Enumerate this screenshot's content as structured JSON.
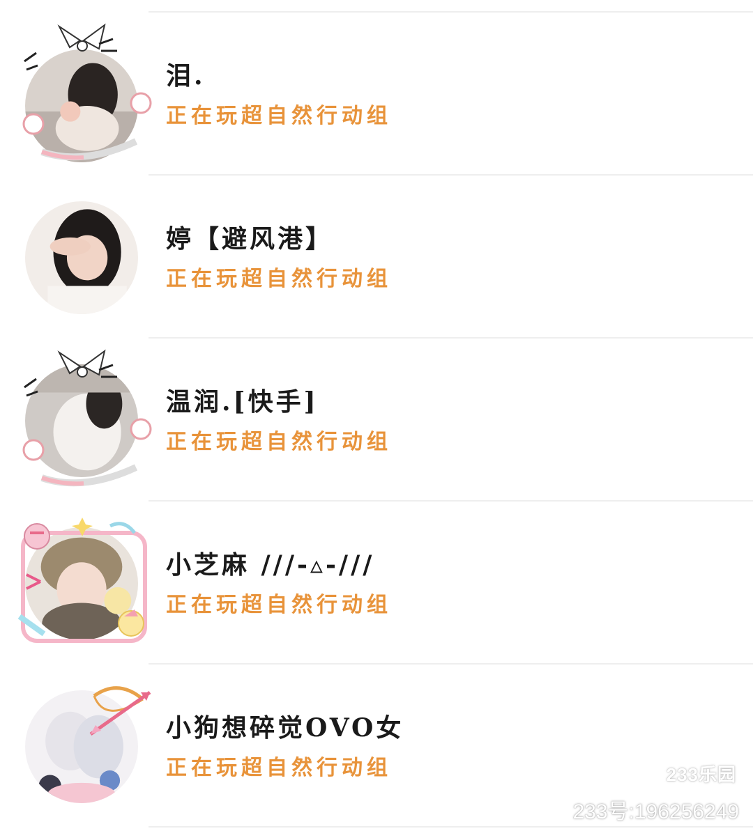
{
  "users": [
    {
      "name": "泪.",
      "status": "正在玩超自然行动组",
      "avatar_frame": "cat-ear-bow-frame"
    },
    {
      "name": "婷【避风港】",
      "status": "正在玩超自然行动组",
      "avatar_frame": "none"
    },
    {
      "name": "温润.[快手]",
      "status": "正在玩超自然行动组",
      "avatar_frame": "cat-ear-bow-frame"
    },
    {
      "name": "小芝麻 ///-▵-///",
      "status": "正在玩超自然行动组",
      "avatar_frame": "dessert-frame"
    },
    {
      "name": "小狗想碎觉OVO女",
      "status": "正在玩超自然行动组",
      "avatar_frame": "cupid-bow-frame"
    }
  ],
  "watermark": {
    "logo": "233乐园",
    "id": "233号:196256249"
  },
  "colors": {
    "name": "#1a1a1a",
    "status": "#e8933a",
    "divider": "#eeeeee",
    "background": "#ffffff"
  }
}
